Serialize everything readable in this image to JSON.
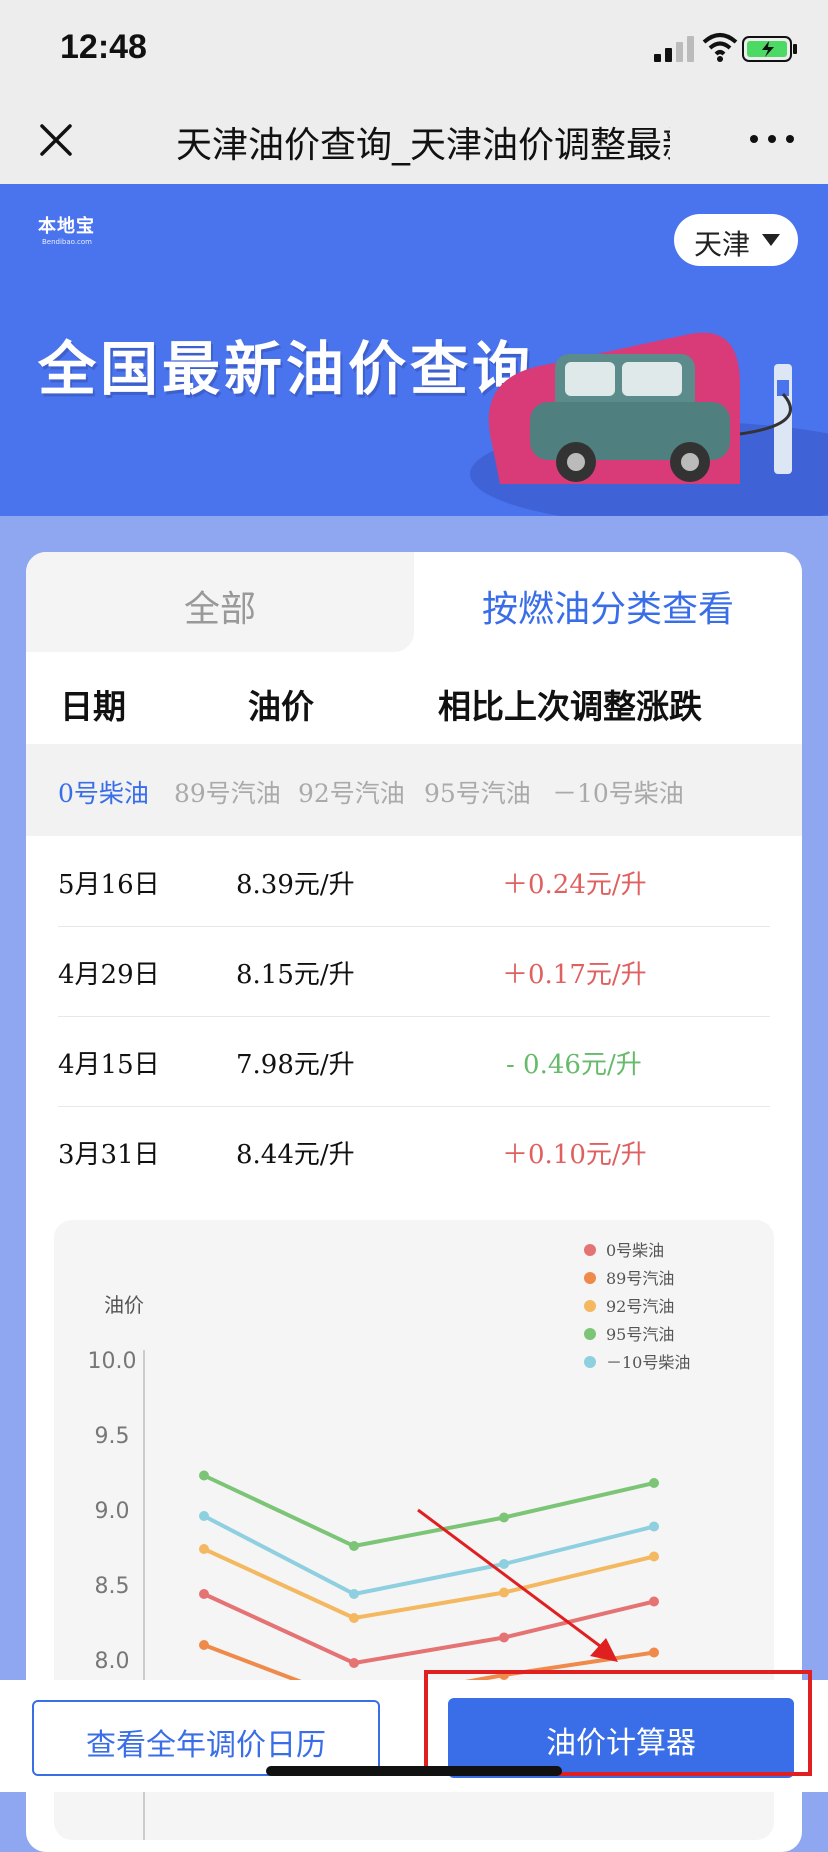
{
  "status_bar": {
    "time": "12:48"
  },
  "nav": {
    "title": "天津油价查询_天津油价调整最新"
  },
  "banner": {
    "logo_text": "本地宝",
    "logo_sub": "Bendibao.com",
    "city": "天津",
    "title": "全国最新油价查询"
  },
  "tabs": [
    {
      "label": "全部",
      "active": false
    },
    {
      "label": "按燃油分类查看",
      "active": true
    }
  ],
  "table": {
    "headers": [
      "日期",
      "油价",
      "相比上次调整涨跌"
    ],
    "fuel_types": [
      "0号柴油",
      "89号汽油",
      "92号汽油",
      "95号汽油",
      "－10号柴油"
    ],
    "active_fuel": "0号柴油",
    "rows": [
      {
        "date": "5月16日",
        "price": "8.39元/升",
        "change": "＋0.24元/升",
        "direction": "up"
      },
      {
        "date": "4月29日",
        "price": "8.15元/升",
        "change": "＋0.17元/升",
        "direction": "up"
      },
      {
        "date": "4月15日",
        "price": "7.98元/升",
        "change": "- 0.46元/升",
        "direction": "down"
      },
      {
        "date": "3月31日",
        "price": "8.44元/升",
        "change": "＋0.10元/升",
        "direction": "up"
      }
    ]
  },
  "chart_data": {
    "type": "line",
    "ylabel": "油价",
    "ylim": [
      8.0,
      10.0
    ],
    "yticks": [
      "10.0",
      "9.5",
      "9.0",
      "8.5",
      "8.0"
    ],
    "legend_position": "top-right",
    "series": [
      {
        "name": "0号柴油",
        "color": "#e57373",
        "values": [
          8.44,
          7.98,
          8.15,
          8.39
        ]
      },
      {
        "name": "89号汽油",
        "color": "#ef8a4a",
        "values": [
          8.1,
          7.72,
          7.9,
          8.05
        ]
      },
      {
        "name": "92号汽油",
        "color": "#f4b860",
        "values": [
          8.74,
          8.28,
          8.45,
          8.69
        ]
      },
      {
        "name": "95号汽油",
        "color": "#7cc576",
        "values": [
          9.23,
          8.76,
          8.95,
          9.18
        ]
      },
      {
        "name": "－10号柴油",
        "color": "#8ecfe0",
        "values": [
          8.96,
          8.44,
          8.64,
          8.89
        ]
      }
    ]
  },
  "bottom": {
    "calendar_label": "查看全年调价日历",
    "calc_label": "油价计算器"
  },
  "colors": {
    "accent": "#3a6ee8",
    "banner": "#4a73ee",
    "up": "#e06060",
    "down": "#66bb6a",
    "highlight": "#e02020"
  }
}
